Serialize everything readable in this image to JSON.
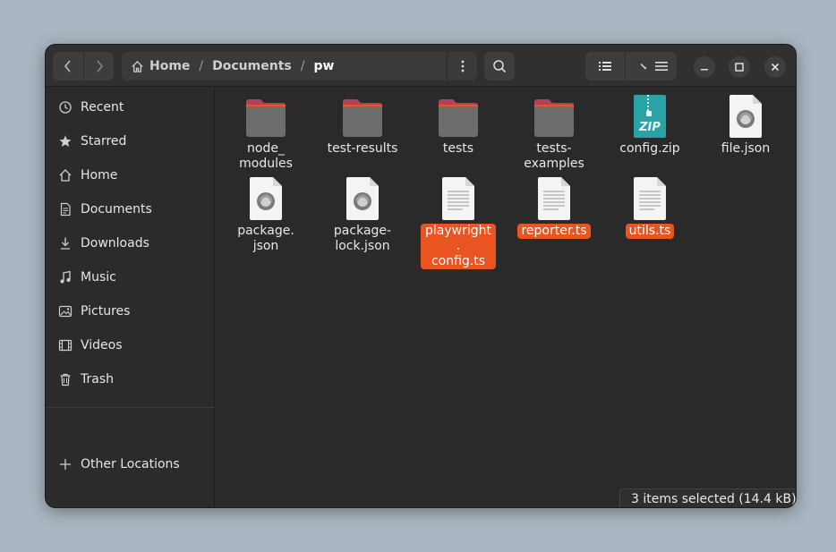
{
  "path": {
    "home": "Home",
    "separator": "/",
    "documents": "Documents",
    "current": "pw"
  },
  "sidebar": {
    "items": [
      {
        "label": "Recent",
        "icon": "clock-icon"
      },
      {
        "label": "Starred",
        "icon": "star-icon"
      },
      {
        "label": "Home",
        "icon": "home-icon"
      },
      {
        "label": "Documents",
        "icon": "document-icon"
      },
      {
        "label": "Downloads",
        "icon": "download-icon"
      },
      {
        "label": "Music",
        "icon": "music-icon"
      },
      {
        "label": "Pictures",
        "icon": "picture-icon"
      },
      {
        "label": "Videos",
        "icon": "video-icon"
      },
      {
        "label": "Trash",
        "icon": "trash-icon"
      }
    ],
    "other_locations": "Other Locations"
  },
  "files": [
    {
      "name": "node_\nmodules",
      "type": "folder",
      "selected": false
    },
    {
      "name": "test-results",
      "type": "folder",
      "selected": false
    },
    {
      "name": "tests",
      "type": "folder",
      "selected": false
    },
    {
      "name": "tests-\nexamples",
      "type": "folder",
      "selected": false
    },
    {
      "name": "config.zip",
      "type": "zip",
      "selected": false
    },
    {
      "name": "file.json",
      "type": "json",
      "selected": false
    },
    {
      "name": "package.\njson",
      "type": "json",
      "selected": false
    },
    {
      "name": "package-\nlock.json",
      "type": "json",
      "selected": false
    },
    {
      "name": "playwright.\nconfig.ts",
      "type": "text",
      "selected": true
    },
    {
      "name": "reporter.ts",
      "type": "text",
      "selected": true
    },
    {
      "name": "utils.ts",
      "type": "text",
      "selected": true
    }
  ],
  "zip_badge": "ZIP",
  "status": "3 items selected  (14.4 kB)",
  "colors": {
    "accent": "#e95420",
    "folder_body": "#6d6d6d",
    "folder_tab": "#b5405c",
    "zip_bg": "#2aa3a6"
  }
}
